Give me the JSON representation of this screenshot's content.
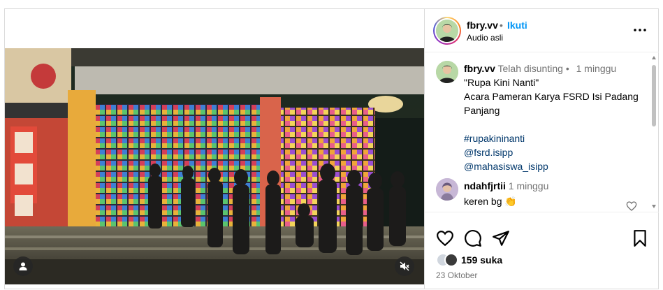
{
  "post": {
    "author": "fbry.vv",
    "separator": "•",
    "follow_label": "Ikuti",
    "audio_label": "Audio asli",
    "more_icon": "more-horizontal-icon"
  },
  "caption": {
    "author": "fbry.vv",
    "edited_label": "Telah disunting",
    "dot": "•",
    "time": "1 minggu",
    "line1": "\"Rupa Kini Nanti\"",
    "line2": "Acara Pameran Karya FSRD Isi Padang Panjang",
    "hashtag": "#rupakininanti",
    "mention1": "@fsrd.isipp",
    "mention2": "@mahasiswa_isipp"
  },
  "comment": {
    "author": "ndahfjrtii",
    "time": "1 minggu",
    "text": "keren bg 👏"
  },
  "actions": {
    "like_icon": "heart-icon",
    "comment_icon": "comment-icon",
    "share_icon": "send-icon",
    "save_icon": "bookmark-icon"
  },
  "likes_label": "159 suka",
  "date": "23 Oktober",
  "video": {
    "user_icon": "user-icon",
    "mute_icon": "muted-speaker-icon"
  },
  "colors": {
    "link": "#00376b",
    "follow": "#0095f6",
    "muted": "#737373"
  }
}
